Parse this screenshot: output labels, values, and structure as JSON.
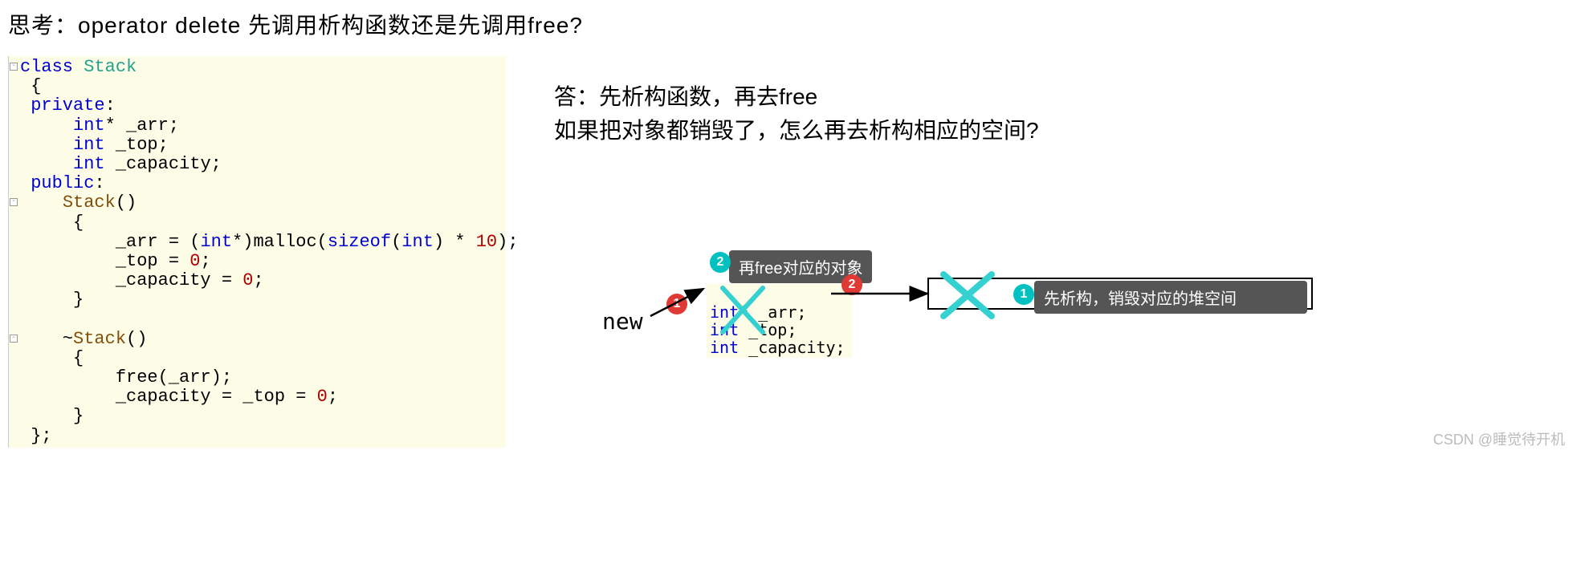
{
  "question": "思考：operator delete 先调用析构函数还是先调用free?",
  "answer_line1": "答：先析构函数，再去free",
  "answer_line2": "如果把对象都销毁了，怎么再去析构相应的空间?",
  "code": {
    "l0": "class Stack",
    "l1": "{",
    "l2": "private:",
    "l3": "    int* _arr;",
    "l4": "    int _top;",
    "l5": "    int _capacity;",
    "l6": "public:",
    "l7": "    Stack()",
    "l8": "    {",
    "l9": "        _arr = (int*)malloc(sizeof(int) * 10);",
    "l10": "        _top = 0;",
    "l11": "        _capacity = 0;",
    "l12": "    }",
    "l13": "",
    "l14": "    ~Stack()",
    "l15": "    {",
    "l16": "        free(_arr);",
    "l17": "        _capacity = _top = 0;",
    "l18": "    }",
    "l19": "};"
  },
  "diagram": {
    "new_label": "new",
    "mini_line1": "int* _arr;",
    "mini_line2": "int _top;",
    "mini_line3": "int _capacity;",
    "callout2": "再free对应的对象",
    "callout1": "先析构，销毁对应的堆空间",
    "badge_red1": "1",
    "badge_teal2": "2",
    "badge_red2": "2",
    "badge_teal1": "1"
  },
  "watermark": "CSDN @睡觉待开机"
}
